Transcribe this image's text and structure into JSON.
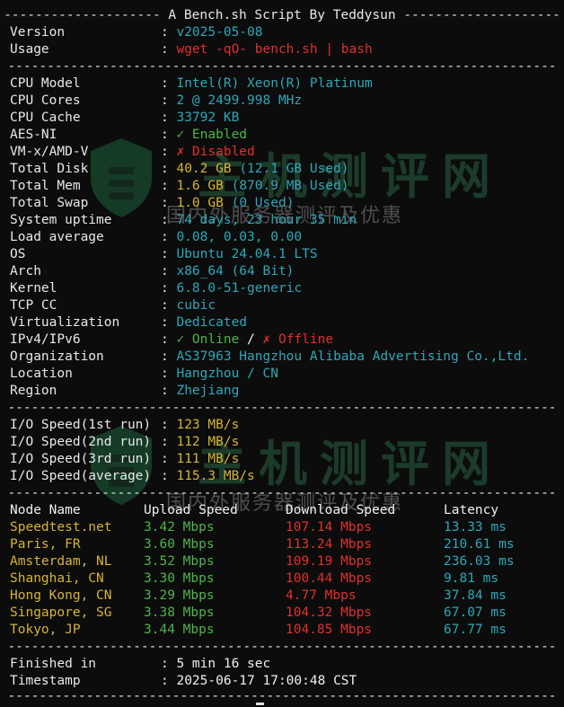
{
  "header": "A Bench.sh Script By Teddysun",
  "info1": [
    {
      "label": "Version",
      "value": "v2025-05-08",
      "color": "c-cyan"
    },
    {
      "label": "Usage",
      "value": "wget -qO- bench.sh | bash",
      "color": "c-red"
    }
  ],
  "sys": {
    "cpu_model": {
      "label": "CPU Model",
      "value": "Intel(R) Xeon(R) Platinum"
    },
    "cpu_cores": {
      "label": "CPU Cores",
      "value": "2 @ 2499.998 MHz"
    },
    "cpu_cache": {
      "label": "CPU Cache",
      "value": "33792 KB"
    },
    "aes": {
      "label": "AES-NI",
      "value": "✓ Enabled"
    },
    "vmx": {
      "label": "VM-x/AMD-V",
      "value": "✗ Disabled"
    },
    "disk": {
      "label": "Total Disk",
      "value": "40.2 GB",
      "used": "(12.1 GB Used)"
    },
    "mem": {
      "label": "Total Mem",
      "value": "1.6 GB",
      "used": "(870.9 MB Used)"
    },
    "swap": {
      "label": "Total Swap",
      "value": "1.0 GB",
      "used": "(0 Used)"
    },
    "uptime": {
      "label": "System uptime",
      "value": "74 days, 23 hour 35 min"
    },
    "load": {
      "label": "Load average",
      "value": "0.08, 0.03, 0.00"
    },
    "os": {
      "label": "OS",
      "value": "Ubuntu 24.04.1 LTS"
    },
    "arch": {
      "label": "Arch",
      "value": "x86_64 (64 Bit)"
    },
    "kernel": {
      "label": "Kernel",
      "value": "6.8.0-51-generic"
    },
    "tcp": {
      "label": "TCP CC",
      "value": "cubic"
    },
    "virt": {
      "label": "Virtualization",
      "value": "Dedicated"
    },
    "ip": {
      "label": "IPv4/IPv6",
      "v4": "✓ Online",
      "slash": " / ",
      "v6": "✗ Offline"
    },
    "org": {
      "label": "Organization",
      "value": "AS37963 Hangzhou Alibaba Advertising Co.,Ltd."
    },
    "loc": {
      "label": "Location",
      "value": "Hangzhou / CN"
    },
    "region": {
      "label": "Region",
      "value": "Zhejiang"
    }
  },
  "io": [
    {
      "label": "I/O Speed(1st run)",
      "value": "123 MB/s"
    },
    {
      "label": "I/O Speed(2nd run)",
      "value": "112 MB/s"
    },
    {
      "label": "I/O Speed(3rd run)",
      "value": "111 MB/s"
    },
    {
      "label": "I/O Speed(average)",
      "value": "115.3 MB/s"
    }
  ],
  "speed": {
    "headers": [
      "Node Name",
      "Upload Speed",
      "Download Speed",
      "Latency"
    ],
    "rows": [
      [
        "Speedtest.net",
        "3.42 Mbps",
        "107.14 Mbps",
        "13.33 ms"
      ],
      [
        "Paris, FR",
        "3.60 Mbps",
        "113.24 Mbps",
        "210.61 ms"
      ],
      [
        "Amsterdam, NL",
        "3.52 Mbps",
        "109.19 Mbps",
        "236.03 ms"
      ],
      [
        "Shanghai, CN",
        "3.30 Mbps",
        "100.44 Mbps",
        "9.81 ms"
      ],
      [
        "Hong Kong, CN",
        "3.29 Mbps",
        "4.77 Mbps",
        "37.84 ms"
      ],
      [
        "Singapore, SG",
        "3.38 Mbps",
        "104.32 Mbps",
        "67.07 ms"
      ],
      [
        "Tokyo, JP",
        "3.44 Mbps",
        "104.85 Mbps",
        "67.77 ms"
      ]
    ]
  },
  "footer": [
    {
      "label": "Finished in",
      "value": "5 min 16 sec"
    },
    {
      "label": "Timestamp",
      "value": "2025-06-17 17:00:48 CST"
    }
  ],
  "watermark": {
    "big": "主机测评网",
    "small": "国内外服务器测评及优惠"
  }
}
